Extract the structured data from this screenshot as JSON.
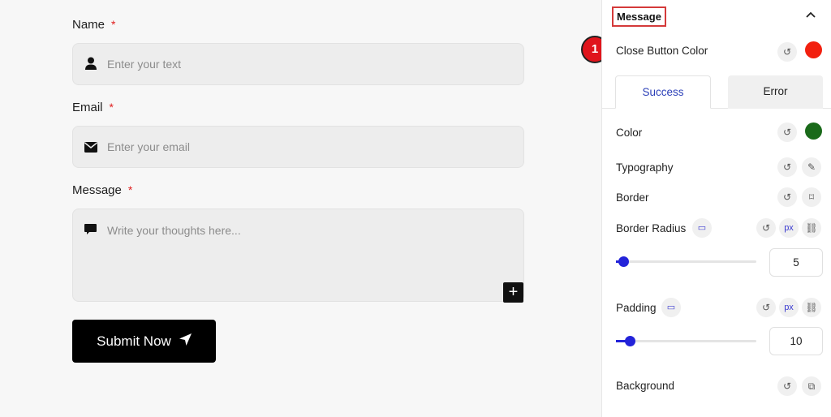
{
  "form": {
    "fields": [
      {
        "label": "Name",
        "required_mark": "*",
        "placeholder": "Enter your text",
        "icon": "user-icon"
      },
      {
        "label": "Email",
        "required_mark": "*",
        "placeholder": "Enter your email",
        "icon": "envelope-icon"
      },
      {
        "label": "Message",
        "required_mark": "*",
        "placeholder": "Write your thoughts here...",
        "icon": "comment-icon"
      }
    ],
    "add_icon": "+",
    "submit_label": "Submit Now",
    "submit_icon": "send-icon"
  },
  "panel": {
    "section_title": "Message",
    "annotation_badge": "1",
    "close_button_color": {
      "label": "Close Button Color",
      "value": "#f2200f"
    },
    "tabs": [
      {
        "label": "Success",
        "active": true
      },
      {
        "label": "Error",
        "active": false
      }
    ],
    "color": {
      "label": "Color",
      "value": "#1a6a1a"
    },
    "typography": {
      "label": "Typography"
    },
    "border": {
      "label": "Border"
    },
    "border_radius": {
      "label": "Border Radius",
      "unit": "px",
      "value": "5",
      "slider_fraction": 0.05
    },
    "padding": {
      "label": "Padding",
      "unit": "px",
      "value": "10",
      "slider_fraction": 0.1
    },
    "background": {
      "label": "Background"
    }
  },
  "colors": {
    "accent": "#2323d9",
    "annotation": "#d43a3a"
  }
}
